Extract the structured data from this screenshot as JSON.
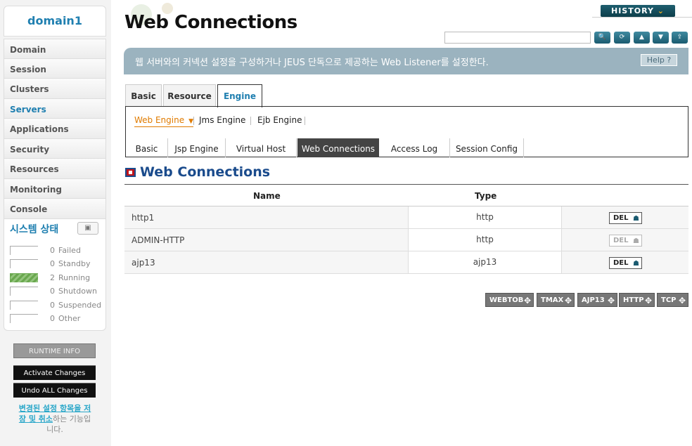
{
  "sidebar": {
    "domain": "domain1",
    "nav": [
      "Domain",
      "Session",
      "Clusters",
      "Servers",
      "Applications",
      "Security",
      "Resources",
      "Monitoring",
      "Console"
    ],
    "active_nav": "Servers",
    "status_title": "시스템 상태",
    "status": [
      {
        "count": "0",
        "label": "Failed"
      },
      {
        "count": "0",
        "label": "Standby"
      },
      {
        "count": "2",
        "label": "Running"
      },
      {
        "count": "0",
        "label": "Shutdown"
      },
      {
        "count": "0",
        "label": "Suspended"
      },
      {
        "count": "0",
        "label": "Other"
      }
    ],
    "runtime_info": "RUNTIME INFO",
    "activate": "Activate Changes",
    "undo": "Undo ALL Changes",
    "note_link": "변경된 설정 항목을 저장 및 취소",
    "note_rest": "하는 기능입니다."
  },
  "header": {
    "title": "Web Connections",
    "history": "HISTORY",
    "search_placeholder": "",
    "tools": [
      "search-icon",
      "refresh-icon",
      "xml-up-icon",
      "xml-down-icon",
      "export-icon"
    ]
  },
  "description": "웹 서버와의 커넥션 설정을 구성하거나 JEUS 단독으로 제공하는 Web Listener를 설정한다.",
  "help": "Help",
  "tabs_top": [
    "Basic",
    "Resource",
    "Engine"
  ],
  "active_top": "Engine",
  "engine_tabs": [
    "Web Engine",
    "Jms Engine",
    "Ejb Engine"
  ],
  "sub_tabs": [
    "Basic",
    "Jsp Engine",
    "Virtual Host",
    "Web Connections",
    "Access Log",
    "Session Config"
  ],
  "active_sub": "Web Connections",
  "section_title": "Web Connections",
  "table": {
    "headers": [
      "Name",
      "Type"
    ],
    "rows": [
      {
        "name": "http1",
        "type": "http",
        "del": "DEL",
        "del_enabled": true
      },
      {
        "name": "ADMIN-HTTP",
        "type": "http",
        "del": "DEL",
        "del_enabled": false
      },
      {
        "name": "ajp13",
        "type": "ajp13",
        "del": "DEL",
        "del_enabled": true
      }
    ]
  },
  "add_buttons": [
    "WEBTOB",
    "TMAX",
    "AJP13",
    "HTTP",
    "TCP"
  ]
}
